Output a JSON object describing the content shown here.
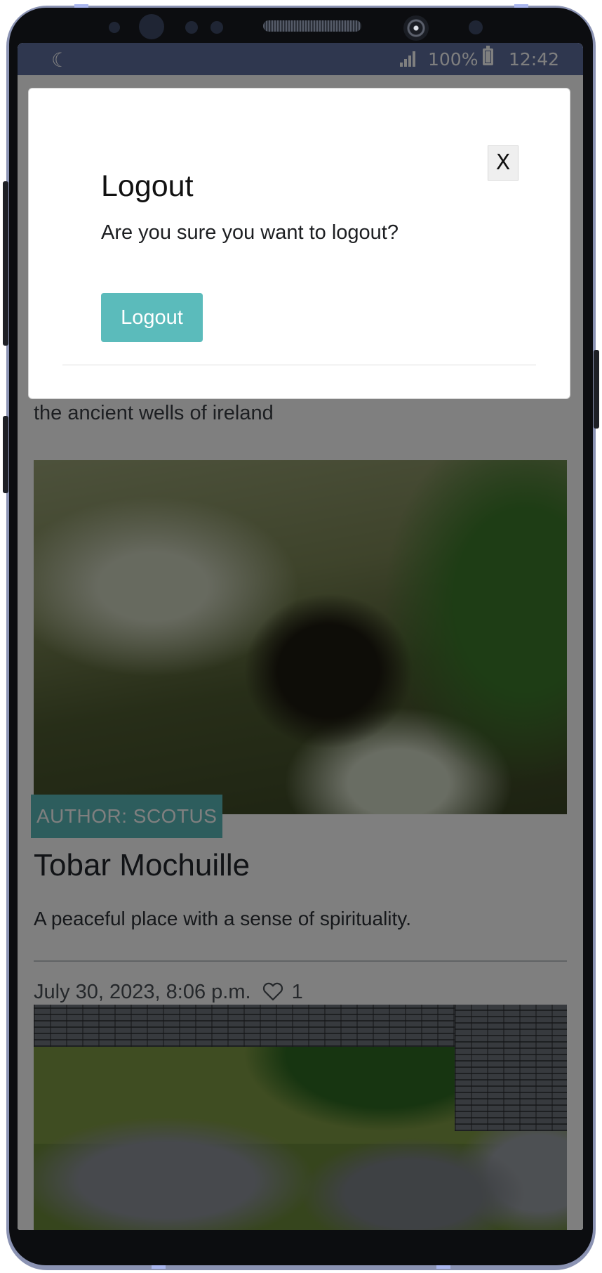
{
  "status_bar": {
    "left_icon": "☾",
    "battery_percent": "100%",
    "time": "12:42"
  },
  "page": {
    "tagline": "the ancient wells of ireland",
    "cards": [
      {
        "author_badge": "AUTHOR: SCOTUS",
        "title": "Tobar Mochuille",
        "excerpt": "A peaceful place with a sense of spirituality.",
        "date": "July 30, 2023, 8:06 p.m.",
        "likes": "1"
      }
    ]
  },
  "modal": {
    "close_label": "X",
    "title": "Logout",
    "body": "Are you sure you want to logout?",
    "logout_button": "Logout"
  },
  "colors": {
    "accent": "#5bbbbb",
    "status_bar": "#5f6f9f",
    "frame": "#8b93b3"
  },
  "icons": [
    "moon-icon",
    "signal-icon",
    "battery-icon",
    "heart-icon",
    "close-icon"
  ]
}
